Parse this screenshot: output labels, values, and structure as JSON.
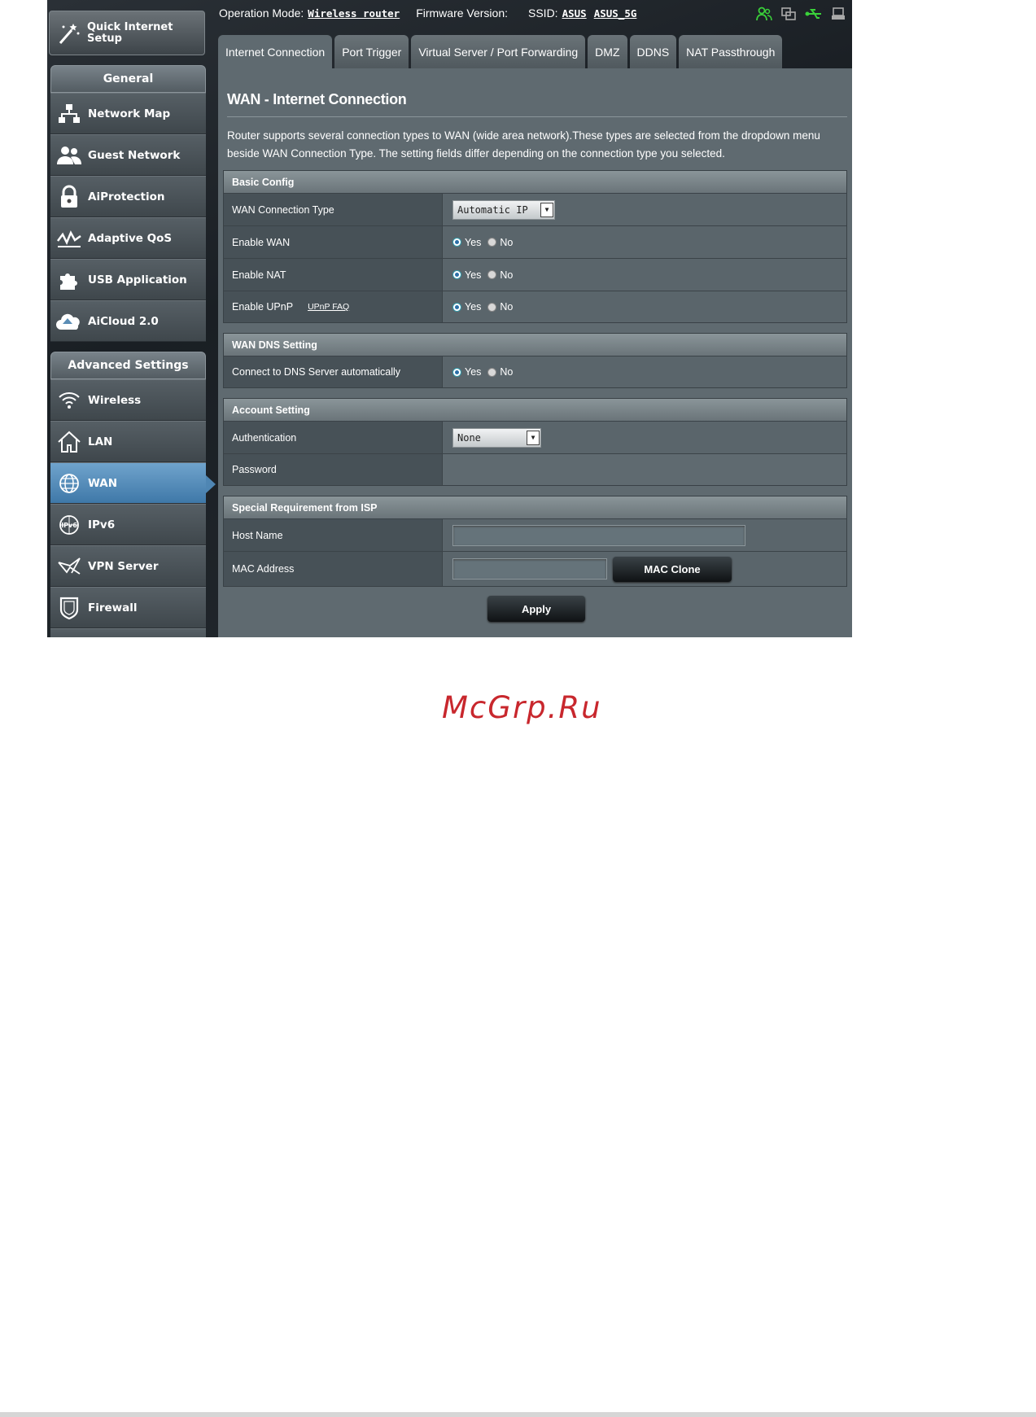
{
  "topbar": {
    "operation_mode_label": "Operation Mode:",
    "operation_mode_value": "Wireless router",
    "firmware_label": "Firmware Version:",
    "ssid_label": "SSID:",
    "ssid_1": "ASUS",
    "ssid_2": "ASUS_5G",
    "status_icons": [
      "users-icon",
      "copy-icon",
      "usb-icon",
      "printer-icon"
    ]
  },
  "sidebar": {
    "quick_setup": "Quick Internet Setup",
    "general_header": "General",
    "general_items": [
      {
        "label": "Network Map",
        "icon": "network-map-icon"
      },
      {
        "label": "Guest Network",
        "icon": "guest-network-icon"
      },
      {
        "label": "AiProtection",
        "icon": "lock-icon"
      },
      {
        "label": "Adaptive QoS",
        "icon": "qos-icon"
      },
      {
        "label": "USB Application",
        "icon": "puzzle-icon"
      },
      {
        "label": "AiCloud 2.0",
        "icon": "cloud-icon"
      }
    ],
    "advanced_header": "Advanced Settings",
    "advanced_items": [
      {
        "label": "Wireless",
        "icon": "wifi-icon"
      },
      {
        "label": "LAN",
        "icon": "home-icon"
      },
      {
        "label": "WAN",
        "icon": "globe-icon"
      },
      {
        "label": "IPv6",
        "icon": "ipv6-icon"
      },
      {
        "label": "VPN Server",
        "icon": "vpn-icon"
      },
      {
        "label": "Firewall",
        "icon": "shield-icon"
      }
    ]
  },
  "tabs": [
    "Internet Connection",
    "Port Trigger",
    "Virtual Server / Port Forwarding",
    "DMZ",
    "DDNS",
    "NAT Passthrough"
  ],
  "main": {
    "title": "WAN - Internet Connection",
    "description": "Router supports several connection types to WAN (wide area network).These types are selected from the dropdown menu beside WAN Connection Type. The setting fields differ depending on the connection type you selected.",
    "yes": "Yes",
    "no": "No",
    "basic": {
      "header": "Basic Config",
      "wan_type_label": "WAN Connection Type",
      "wan_type_value": "Automatic IP",
      "enable_wan": "Enable WAN",
      "enable_nat": "Enable NAT",
      "enable_upnp": "Enable UPnP",
      "upnp_faq": "UPnP  FAQ"
    },
    "dns": {
      "header": "WAN DNS Setting",
      "auto_label": "Connect to DNS Server automatically"
    },
    "account": {
      "header": "Account Setting",
      "auth_label": "Authentication",
      "auth_value": "None",
      "password_label": "Password"
    },
    "isp": {
      "header": "Special Requirement from ISP",
      "host_label": "Host Name",
      "host_value": "",
      "mac_label": "MAC Address",
      "mac_value": "",
      "mac_clone": "MAC Clone"
    },
    "apply": "Apply"
  },
  "watermark": "McGrp.Ru"
}
